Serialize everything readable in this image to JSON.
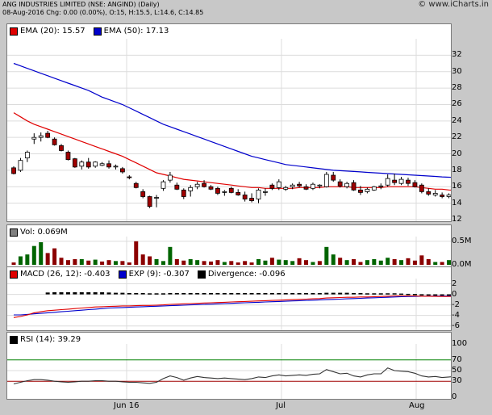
{
  "header": {
    "title": "ANG INDUSTRIES LIMITED (NSE: ANGIND) (Daily)",
    "quote": "08-Aug-2016 Chg: 0.00 (0.00%), O:15, H:15.5, L:14.6, C:14.85",
    "logo": "© www.iCharts.in"
  },
  "colors": {
    "ema20": "#e00000",
    "ema50": "#0000cc",
    "up": "#ffffff",
    "down": "#a00000",
    "vol_up": "#006400",
    "vol_down": "#8b0000",
    "macd": "#e00000",
    "exp": "#0000cc",
    "div": "#000000",
    "rsi": "#333333",
    "rsi_lines": "#008000"
  },
  "chart_data": [
    {
      "type": "candlestick",
      "title": "Price",
      "legend": [
        "EMA (20): 15.57",
        "EMA (50): 17.13"
      ],
      "ylim": [
        12,
        34
      ],
      "yticks": [
        12,
        14,
        16,
        18,
        20,
        22,
        24,
        26,
        28,
        30,
        32
      ],
      "candles": [
        [
          18.3,
          18.5,
          17.5,
          17.6
        ],
        [
          18.0,
          19.5,
          17.8,
          19.2
        ],
        [
          19.5,
          20.4,
          19.0,
          20.2
        ],
        [
          21.8,
          22.5,
          21.2,
          22.0
        ],
        [
          22.0,
          22.6,
          21.5,
          22.2
        ],
        [
          22.5,
          22.8,
          21.9,
          22.0
        ],
        [
          21.8,
          22.0,
          21.0,
          21.1
        ],
        [
          21.0,
          21.2,
          20.3,
          20.4
        ],
        [
          20.2,
          20.4,
          19.2,
          19.3
        ],
        [
          19.4,
          19.5,
          18.3,
          18.4
        ],
        [
          18.5,
          19.2,
          18.1,
          19.0
        ],
        [
          19.0,
          19.5,
          18.2,
          18.4
        ],
        [
          18.5,
          19.1,
          18.3,
          19.0
        ],
        [
          18.6,
          19.0,
          18.5,
          18.8
        ],
        [
          18.8,
          19.2,
          18.2,
          18.4
        ],
        [
          18.4,
          18.7,
          18.1,
          18.5
        ],
        [
          18.2,
          18.4,
          17.6,
          17.8
        ],
        [
          17.2,
          17.4,
          16.9,
          17.1
        ],
        [
          16.4,
          16.6,
          15.8,
          15.9
        ],
        [
          15.4,
          15.7,
          14.6,
          14.8
        ],
        [
          14.8,
          14.9,
          13.4,
          13.6
        ],
        [
          14.6,
          15.0,
          13.5,
          14.7
        ],
        [
          15.8,
          16.8,
          15.5,
          16.6
        ],
        [
          16.8,
          17.8,
          16.5,
          17.4
        ],
        [
          16.2,
          16.5,
          15.6,
          15.7
        ],
        [
          15.6,
          15.8,
          14.5,
          14.8
        ],
        [
          15.5,
          16.2,
          14.8,
          15.9
        ],
        [
          16.0,
          16.6,
          15.7,
          16.3
        ],
        [
          16.4,
          16.8,
          15.9,
          16.0
        ],
        [
          16.0,
          16.2,
          15.6,
          15.7
        ],
        [
          15.8,
          16.0,
          15.0,
          15.2
        ],
        [
          15.3,
          15.6,
          14.9,
          15.4
        ],
        [
          15.8,
          16.0,
          15.2,
          15.3
        ],
        [
          15.3,
          15.7,
          14.9,
          15.0
        ],
        [
          15.0,
          15.4,
          14.2,
          14.5
        ],
        [
          14.6,
          15.2,
          14.1,
          14.3
        ],
        [
          14.5,
          15.8,
          14.0,
          15.6
        ],
        [
          15.3,
          15.8,
          14.9,
          15.4
        ],
        [
          16.2,
          16.4,
          15.6,
          15.8
        ],
        [
          15.9,
          16.9,
          15.6,
          16.6
        ],
        [
          15.7,
          16.1,
          15.5,
          15.9
        ],
        [
          16.0,
          16.4,
          15.7,
          16.2
        ],
        [
          16.3,
          16.6,
          15.9,
          16.1
        ],
        [
          16.0,
          16.3,
          15.6,
          15.7
        ],
        [
          15.8,
          16.5,
          15.6,
          16.3
        ],
        [
          16.1,
          16.3,
          15.8,
          16.2
        ],
        [
          16.0,
          17.8,
          15.9,
          17.5
        ],
        [
          17.4,
          17.8,
          16.6,
          16.8
        ],
        [
          16.6,
          16.9,
          15.9,
          16.1
        ],
        [
          16.0,
          16.6,
          15.8,
          16.4
        ],
        [
          16.5,
          16.8,
          15.5,
          15.6
        ],
        [
          15.6,
          16.1,
          15.0,
          15.3
        ],
        [
          15.4,
          15.9,
          15.2,
          15.7
        ],
        [
          15.6,
          16.1,
          15.5,
          16.0
        ],
        [
          16.0,
          16.4,
          15.7,
          16.1
        ],
        [
          16.2,
          17.5,
          16.0,
          17.0
        ],
        [
          16.8,
          17.6,
          16.2,
          16.5
        ],
        [
          16.4,
          17.2,
          16.2,
          16.9
        ],
        [
          16.8,
          17.1,
          16.1,
          16.4
        ],
        [
          16.5,
          16.8,
          15.9,
          16.0
        ],
        [
          16.2,
          16.4,
          15.2,
          15.4
        ],
        [
          15.4,
          15.8,
          14.9,
          15.1
        ],
        [
          15.0,
          15.6,
          14.8,
          15.2
        ],
        [
          15.0,
          15.3,
          14.6,
          14.8
        ],
        [
          14.8,
          15.2,
          14.6,
          15.0
        ],
        [
          15.0,
          15.5,
          14.6,
          14.85
        ]
      ],
      "ema20": [
        25.0,
        24.5,
        24.0,
        23.6,
        23.3,
        23.0,
        22.7,
        22.4,
        22.1,
        21.8,
        21.5,
        21.2,
        20.9,
        20.6,
        20.3,
        20.0,
        19.7,
        19.3,
        18.9,
        18.5,
        18.1,
        17.7,
        17.5,
        17.3,
        17.1,
        16.9,
        16.8,
        16.7,
        16.6,
        16.5,
        16.4,
        16.3,
        16.2,
        16.1,
        16.0,
        15.9,
        15.9,
        15.8,
        15.8,
        15.8,
        15.8,
        15.8,
        15.9,
        15.9,
        15.9,
        15.9,
        16.0,
        16.0,
        16.0,
        16.0,
        15.9,
        15.9,
        15.9,
        15.9,
        15.9,
        16.0,
        16.0,
        16.0,
        16.0,
        16.0,
        15.9,
        15.8,
        15.7,
        15.7,
        15.6,
        15.57
      ],
      "ema50": [
        31.0,
        30.7,
        30.4,
        30.1,
        29.8,
        29.5,
        29.2,
        28.9,
        28.6,
        28.3,
        28.0,
        27.7,
        27.3,
        26.9,
        26.6,
        26.3,
        26.0,
        25.6,
        25.2,
        24.8,
        24.4,
        24.0,
        23.6,
        23.3,
        23.0,
        22.7,
        22.4,
        22.1,
        21.8,
        21.5,
        21.2,
        20.9,
        20.6,
        20.3,
        20.0,
        19.7,
        19.5,
        19.3,
        19.1,
        18.9,
        18.7,
        18.6,
        18.5,
        18.4,
        18.3,
        18.2,
        18.1,
        18.0,
        17.95,
        17.9,
        17.85,
        17.8,
        17.75,
        17.7,
        17.65,
        17.6,
        17.55,
        17.5,
        17.45,
        17.4,
        17.35,
        17.3,
        17.25,
        17.2,
        17.16,
        17.13
      ]
    },
    {
      "type": "bar",
      "title": "Volume",
      "legend": [
        "Vol: 0.069M"
      ],
      "ylim": [
        0,
        0.6
      ],
      "yticks": [
        "0.0M",
        "0.5M"
      ],
      "values": [
        0.05,
        0.18,
        0.22,
        0.4,
        0.48,
        0.25,
        0.35,
        0.15,
        0.1,
        0.12,
        0.12,
        0.09,
        0.11,
        0.07,
        0.1,
        0.08,
        0.08,
        0.05,
        0.5,
        0.22,
        0.18,
        0.12,
        0.08,
        0.38,
        0.12,
        0.09,
        0.12,
        0.1,
        0.08,
        0.07,
        0.1,
        0.06,
        0.08,
        0.05,
        0.08,
        0.05,
        0.12,
        0.09,
        0.15,
        0.11,
        0.1,
        0.08,
        0.14,
        0.1,
        0.06,
        0.08,
        0.38,
        0.22,
        0.15,
        0.1,
        0.12,
        0.06,
        0.1,
        0.12,
        0.09,
        0.15,
        0.12,
        0.1,
        0.14,
        0.09,
        0.2,
        0.12,
        0.06,
        0.06,
        0.1,
        0.069
      ],
      "up": [
        0,
        1,
        1,
        1,
        1,
        0,
        0,
        0,
        0,
        0,
        1,
        0,
        1,
        0,
        0,
        1,
        0,
        0,
        0,
        0,
        0,
        1,
        1,
        1,
        0,
        0,
        1,
        1,
        0,
        0,
        0,
        1,
        0,
        0,
        0,
        0,
        1,
        1,
        0,
        1,
        1,
        1,
        0,
        0,
        1,
        0,
        1,
        1,
        0,
        1,
        0,
        0,
        1,
        1,
        1,
        1,
        0,
        1,
        0,
        0,
        0,
        0,
        1,
        0,
        1,
        1
      ]
    },
    {
      "type": "line",
      "title": "MACD",
      "legend": [
        "MACD (26, 12): -0.403",
        "EXP (9): -0.307",
        "Divergence: -0.096"
      ],
      "ylim": [
        -6.5,
        3
      ],
      "yticks": [
        2,
        0,
        -2,
        -4,
        -6
      ],
      "macd": [
        -4.4,
        -4.2,
        -3.9,
        -3.5,
        -3.3,
        -3.1,
        -3.0,
        -2.9,
        -2.8,
        -2.7,
        -2.6,
        -2.5,
        -2.4,
        -2.35,
        -2.3,
        -2.25,
        -2.2,
        -2.2,
        -2.15,
        -2.1,
        -2.1,
        -2.05,
        -2.0,
        -1.9,
        -1.85,
        -1.8,
        -1.75,
        -1.7,
        -1.65,
        -1.6,
        -1.55,
        -1.5,
        -1.45,
        -1.4,
        -1.35,
        -1.3,
        -1.25,
        -1.2,
        -1.15,
        -1.1,
        -1.05,
        -1.0,
        -0.95,
        -0.9,
        -0.85,
        -0.8,
        -0.7,
        -0.65,
        -0.6,
        -0.55,
        -0.55,
        -0.5,
        -0.5,
        -0.45,
        -0.4,
        -0.35,
        -0.3,
        -0.3,
        -0.3,
        -0.3,
        -0.35,
        -0.35,
        -0.38,
        -0.4,
        -0.4,
        -0.403
      ],
      "exp": [
        -3.9,
        -3.9,
        -3.8,
        -3.7,
        -3.6,
        -3.5,
        -3.4,
        -3.3,
        -3.2,
        -3.1,
        -3.0,
        -2.9,
        -2.8,
        -2.7,
        -2.6,
        -2.55,
        -2.5,
        -2.45,
        -2.4,
        -2.35,
        -2.3,
        -2.25,
        -2.2,
        -2.15,
        -2.1,
        -2.05,
        -2.0,
        -1.95,
        -1.9,
        -1.85,
        -1.8,
        -1.75,
        -1.7,
        -1.65,
        -1.6,
        -1.55,
        -1.5,
        -1.45,
        -1.4,
        -1.35,
        -1.3,
        -1.25,
        -1.2,
        -1.15,
        -1.1,
        -1.05,
        -1.0,
        -0.95,
        -0.9,
        -0.85,
        -0.8,
        -0.75,
        -0.7,
        -0.65,
        -0.6,
        -0.55,
        -0.5,
        -0.45,
        -0.4,
        -0.38,
        -0.36,
        -0.34,
        -0.33,
        -0.32,
        -0.31,
        -0.307
      ],
      "divergence": [
        0,
        0,
        0,
        0,
        0,
        0.35,
        0.4,
        0.4,
        0.4,
        0.4,
        0.4,
        0.4,
        0.4,
        0.4,
        0.35,
        0.3,
        0.3,
        0.25,
        0.25,
        0.25,
        0.2,
        0.2,
        0.2,
        0.25,
        0.25,
        0.25,
        0.25,
        0.25,
        0.25,
        0.25,
        0.25,
        0.25,
        0.25,
        0.25,
        0.25,
        0.25,
        0.25,
        0.25,
        0.25,
        0.25,
        0.25,
        0.25,
        0.25,
        0.25,
        0.25,
        0.25,
        0.3,
        0.3,
        0.3,
        0.3,
        0.25,
        0.25,
        0.2,
        0.2,
        0.2,
        0.2,
        0.2,
        0.15,
        0.1,
        0.08,
        0.02,
        -0.01,
        -0.05,
        -0.08,
        -0.09,
        -0.096
      ]
    },
    {
      "type": "line",
      "title": "RSI",
      "legend": [
        "RSI (14): 39.29"
      ],
      "ylim": [
        0,
        100
      ],
      "yticks": [
        100,
        70,
        50,
        30,
        0
      ],
      "levels": [
        70,
        30
      ],
      "values": [
        25,
        28,
        31,
        33,
        33,
        32,
        30,
        29,
        28,
        29,
        30,
        30,
        31,
        31,
        30,
        30,
        29,
        28,
        28,
        27,
        26,
        28,
        35,
        40,
        37,
        32,
        36,
        39,
        37,
        36,
        35,
        36,
        35,
        34,
        33,
        35,
        38,
        37,
        40,
        42,
        40,
        41,
        42,
        41,
        43,
        44,
        52,
        48,
        44,
        45,
        40,
        38,
        42,
        44,
        44,
        55,
        50,
        49,
        48,
        45,
        40,
        38,
        39,
        37,
        38,
        39.29
      ]
    }
  ],
  "x_axis": {
    "labels": [
      "Jun 16",
      "Jul",
      "Aug"
    ]
  }
}
